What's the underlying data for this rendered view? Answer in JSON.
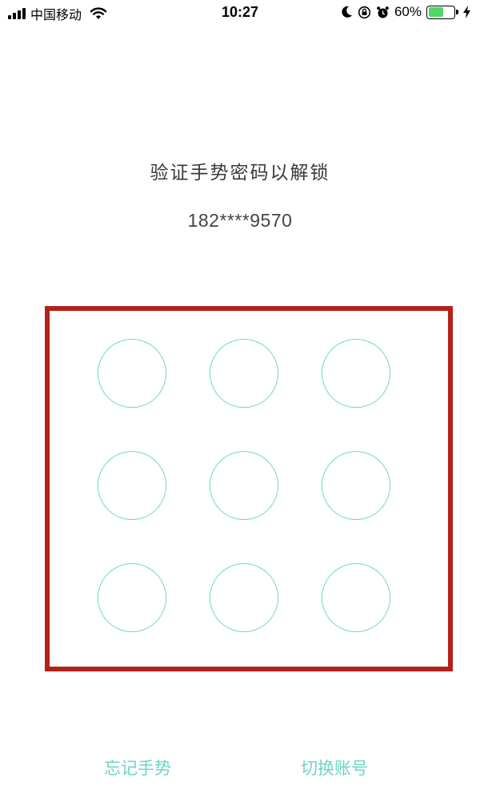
{
  "status_bar": {
    "carrier": "中国移动",
    "time": "10:27",
    "battery_percent": "60%",
    "battery_level": 0.6,
    "icons": [
      "signal-icon",
      "wifi-icon",
      "moon-icon",
      "rotation-lock-icon",
      "alarm-icon",
      "battery-icon",
      "charging-icon"
    ],
    "battery_color": "#4cd964"
  },
  "lock": {
    "title": "验证手势密码以解锁",
    "phone_masked": "182****9570",
    "dot_count": 9,
    "dot_color": "#6fd8c9",
    "frame_color": "#b32219"
  },
  "actions": {
    "forgot_label": "忘记手势",
    "switch_label": "切换账号",
    "link_color": "#6fd3c5"
  }
}
